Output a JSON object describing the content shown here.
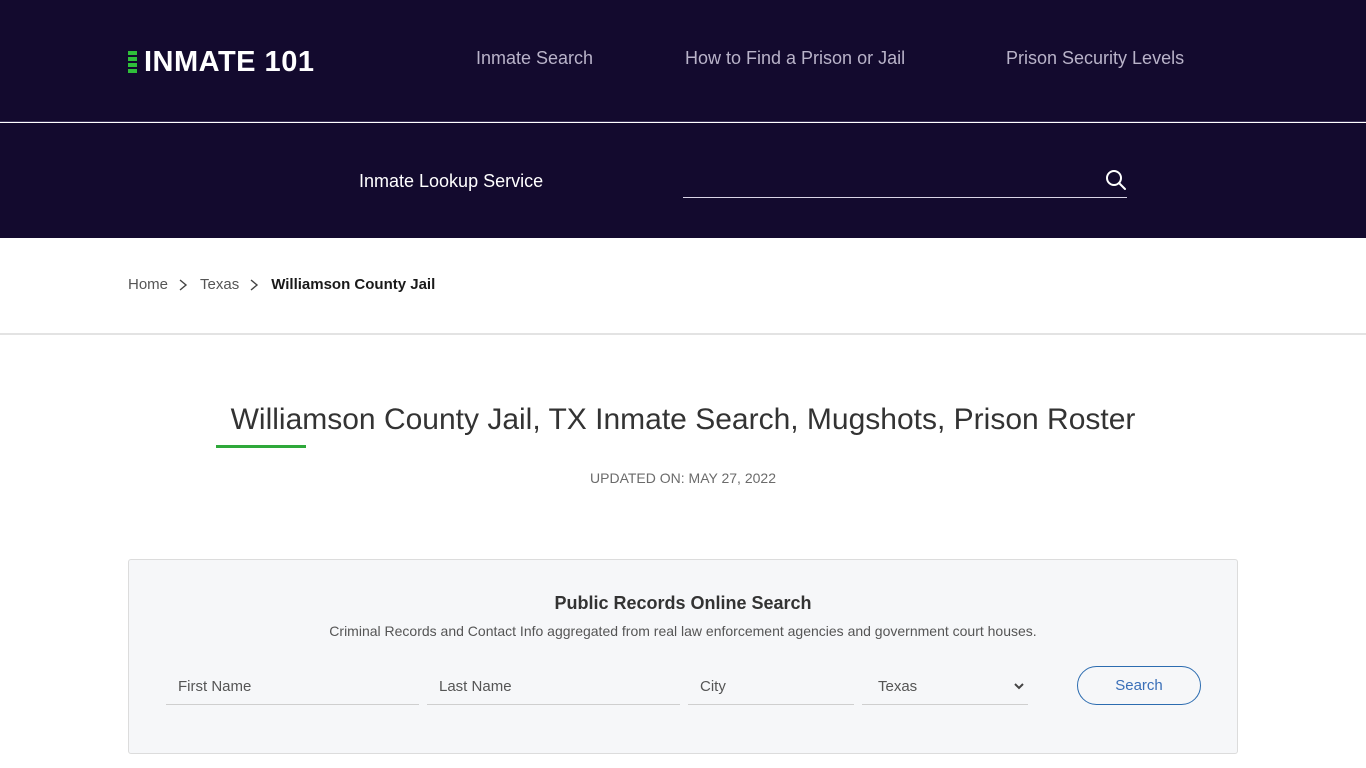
{
  "header": {
    "logo_text": "INMATE 101",
    "nav": [
      {
        "label": "Inmate Search"
      },
      {
        "label": "How to Find a Prison or Jail"
      },
      {
        "label": "Prison Security Levels"
      }
    ]
  },
  "lookup": {
    "label": "Inmate Lookup Service",
    "search_value": "",
    "search_placeholder": "",
    "icon": "search-icon"
  },
  "breadcrumb": {
    "items": [
      {
        "label": "Home"
      },
      {
        "label": "Texas"
      }
    ],
    "current": "Williamson County Jail",
    "separator_icon": "chevron-right-icon"
  },
  "page": {
    "title": "Williamson County Jail, TX Inmate Search, Mugshots, Prison Roster",
    "updated": "UPDATED ON: MAY 27, 2022"
  },
  "records_search": {
    "title": "Public Records Online Search",
    "subtitle": "Criminal Records and Contact Info aggregated from real law enforcement agencies and government court houses.",
    "first_name_placeholder": "First Name",
    "last_name_placeholder": "Last Name",
    "city_placeholder": "City",
    "state_selected": "Texas",
    "search_label": "Search"
  },
  "colors": {
    "header_bg": "#130a2e",
    "accent_green": "#2ea83a",
    "button_blue": "#2c6cb0"
  }
}
